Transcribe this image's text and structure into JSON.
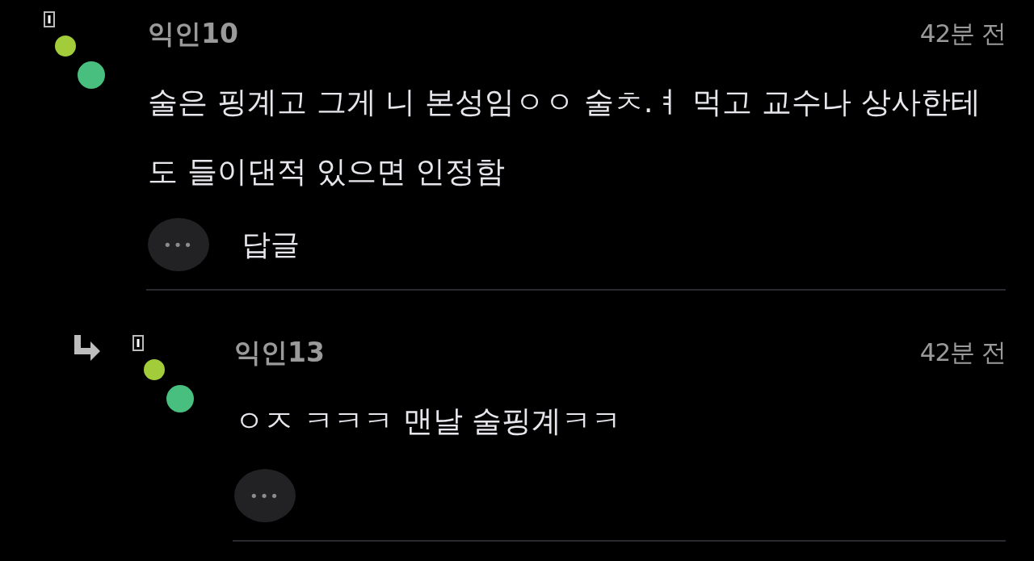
{
  "comments": [
    {
      "kind": "comment",
      "author": "익인10",
      "time": "42분 전",
      "text": "술은 핑계고 그게 니 본성임ㅇㅇ 술ㅊ.ㅕ 먹고 교수나 상사한테도 들이댄적 있으면 인정함",
      "more_label": "•••",
      "reply_label": "답글"
    },
    {
      "kind": "reply",
      "author": "익인13",
      "time": "42분 전",
      "text": "ㅇㅈ ㅋㅋㅋ 맨날 술핑계ㅋㅋ",
      "more_label": "•••"
    }
  ]
}
